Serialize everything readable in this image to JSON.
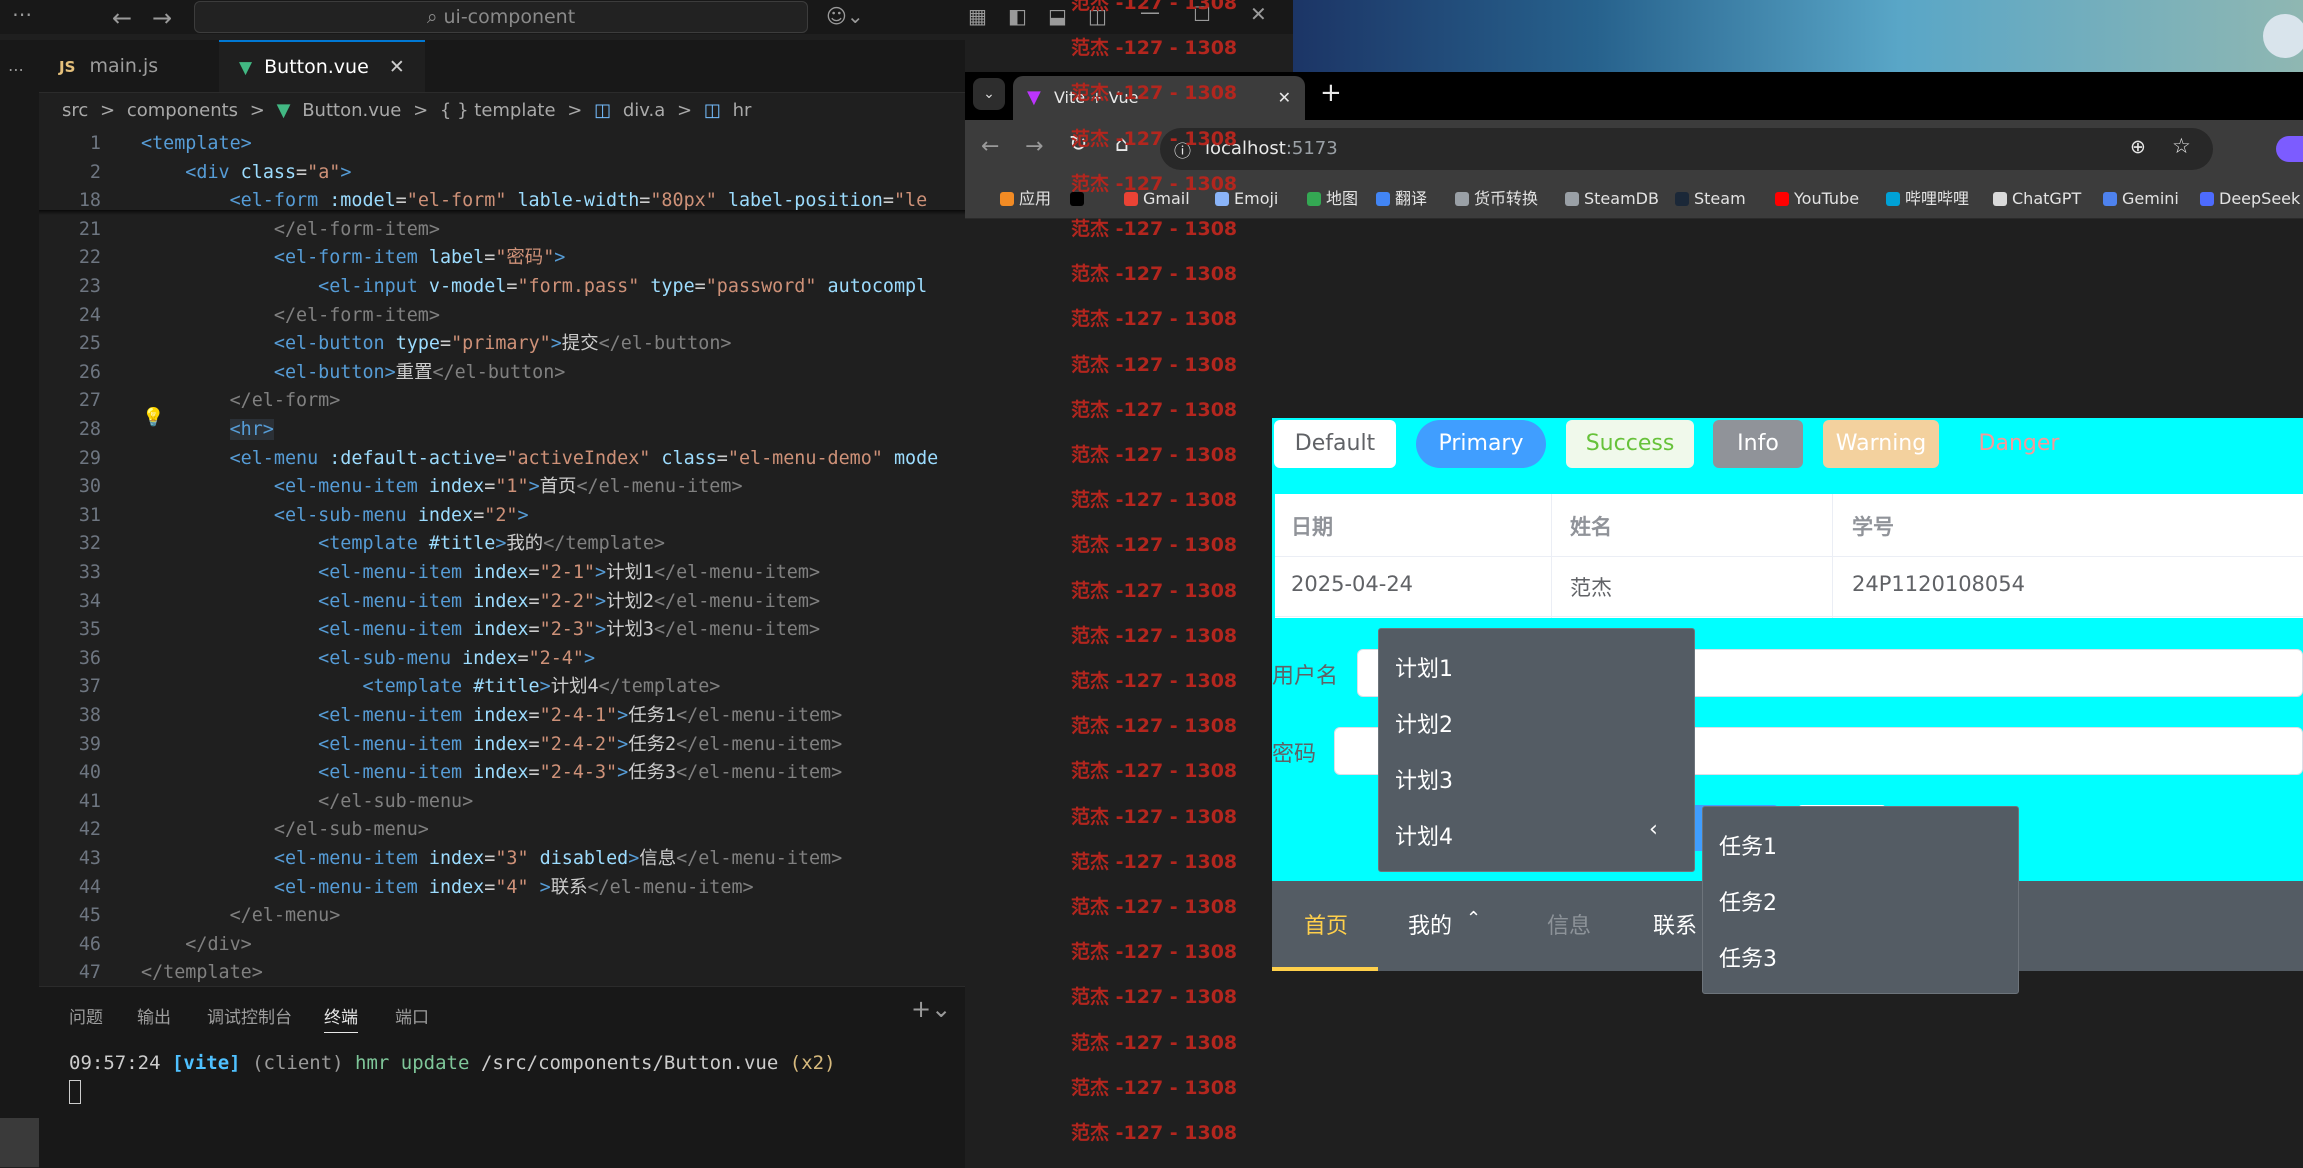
{
  "vscode": {
    "search": "ui-component",
    "tabs": [
      "main.js",
      "Button.vue"
    ],
    "tab_js_badge": "JS",
    "breadcrumb": [
      "src",
      ">",
      "components",
      ">",
      "Button.vue",
      ">",
      "{ } template",
      ">",
      "div.a",
      ">",
      "hr"
    ],
    "code_lines": [
      {
        "n": "1",
        "html": "<span class='tg'>&lt;template&gt;</span>"
      },
      {
        "n": "2",
        "html": "    <span class='tg'>&lt;div</span> <span class='at'>class</span>=<span class='st'>\"a\"</span><span class='tg'>&gt;</span>"
      },
      {
        "n": "18",
        "html": "        <span class='tg'>&lt;el-form</span> <span class='at'>:model</span>=<span class='st'>\"el-form\"</span> <span class='at'>lable-width</span>=<span class='st'>\"80px\"</span> <span class='at'>label-position</span>=<span class='st'>\"le</span>"
      },
      {
        "n": "21",
        "html": "            <span class='gy'>&lt;/el-form-item&gt;</span>"
      },
      {
        "n": "22",
        "html": "            <span class='tg'>&lt;el-form-item</span> <span class='at'>label</span>=<span class='st'>\"密码\"</span><span class='tg'>&gt;</span>"
      },
      {
        "n": "23",
        "html": "                <span class='tg'>&lt;el-input</span> <span class='at'>v-model</span>=<span class='st'>\"form.pass\"</span> <span class='at'>type</span>=<span class='st'>\"password\"</span> <span class='at'>autocompl</span>"
      },
      {
        "n": "24",
        "html": "            <span class='gy'>&lt;/el-form-item&gt;</span>"
      },
      {
        "n": "25",
        "html": "            <span class='tg'>&lt;el-button</span> <span class='at'>type</span>=<span class='st'>\"primary\"</span><span class='tg'>&gt;</span>提交<span class='gy'>&lt;/el-button&gt;</span>"
      },
      {
        "n": "26",
        "html": "            <span class='tg'>&lt;el-button&gt;</span>重置<span class='gy'>&lt;/el-button&gt;</span>"
      },
      {
        "n": "27",
        "html": "        <span class='gy'>&lt;/el-form&gt;</span>"
      },
      {
        "n": "28",
        "html": "        <span class='tg hl'>&lt;hr&gt;</span>"
      },
      {
        "n": "29",
        "html": "        <span class='tg'>&lt;el-menu</span> <span class='at'>:default-active</span>=<span class='st'>\"activeIndex\"</span> <span class='at'>class</span>=<span class='st'>\"el-menu-demo\"</span> <span class='at'>mode</span>"
      },
      {
        "n": "30",
        "html": "            <span class='tg'>&lt;el-menu-item</span> <span class='at'>index</span>=<span class='st'>\"1\"</span><span class='tg'>&gt;</span>首页<span class='gy'>&lt;/el-menu-item&gt;</span>"
      },
      {
        "n": "31",
        "html": "            <span class='tg'>&lt;el-sub-menu</span> <span class='at'>index</span>=<span class='st'>\"2\"</span><span class='tg'>&gt;</span>"
      },
      {
        "n": "32",
        "html": "                <span class='tg'>&lt;template</span> <span class='at'>#title</span><span class='tg'>&gt;</span>我的<span class='gy'>&lt;/template&gt;</span>"
      },
      {
        "n": "33",
        "html": "                <span class='tg'>&lt;el-menu-item</span> <span class='at'>index</span>=<span class='st'>\"2-1\"</span><span class='tg'>&gt;</span>计划1<span class='gy'>&lt;/el-menu-item&gt;</span>"
      },
      {
        "n": "34",
        "html": "                <span class='tg'>&lt;el-menu-item</span> <span class='at'>index</span>=<span class='st'>\"2-2\"</span><span class='tg'>&gt;</span>计划2<span class='gy'>&lt;/el-menu-item&gt;</span>"
      },
      {
        "n": "35",
        "html": "                <span class='tg'>&lt;el-menu-item</span> <span class='at'>index</span>=<span class='st'>\"2-3\"</span><span class='tg'>&gt;</span>计划3<span class='gy'>&lt;/el-menu-item&gt;</span>"
      },
      {
        "n": "36",
        "html": "                <span class='tg'>&lt;el-sub-menu</span> <span class='at'>index</span>=<span class='st'>\"2-4\"</span><span class='tg'>&gt;</span>"
      },
      {
        "n": "37",
        "html": "                    <span class='tg'>&lt;template</span> <span class='at'>#title</span><span class='tg'>&gt;</span>计划4<span class='gy'>&lt;/template&gt;</span>"
      },
      {
        "n": "38",
        "html": "                <span class='tg'>&lt;el-menu-item</span> <span class='at'>index</span>=<span class='st'>\"2-4-1\"</span><span class='tg'>&gt;</span>任务1<span class='gy'>&lt;/el-menu-item&gt;</span>"
      },
      {
        "n": "39",
        "html": "                <span class='tg'>&lt;el-menu-item</span> <span class='at'>index</span>=<span class='st'>\"2-4-2\"</span><span class='tg'>&gt;</span>任务2<span class='gy'>&lt;/el-menu-item&gt;</span>"
      },
      {
        "n": "40",
        "html": "                <span class='tg'>&lt;el-menu-item</span> <span class='at'>index</span>=<span class='st'>\"2-4-3\"</span><span class='tg'>&gt;</span>任务3<span class='gy'>&lt;/el-menu-item&gt;</span>"
      },
      {
        "n": "41",
        "html": "                <span class='gy'>&lt;/el-sub-menu&gt;</span>"
      },
      {
        "n": "42",
        "html": "            <span class='gy'>&lt;/el-sub-menu&gt;</span>"
      },
      {
        "n": "43",
        "html": "            <span class='tg'>&lt;el-menu-item</span> <span class='at'>index</span>=<span class='st'>\"3\"</span> <span class='at'>disabled</span><span class='tg'>&gt;</span>信息<span class='gy'>&lt;/el-menu-item&gt;</span>"
      },
      {
        "n": "44",
        "html": "            <span class='tg'>&lt;el-menu-item</span> <span class='at'>index</span>=<span class='st'>\"4\"</span> <span class='tg'>&gt;</span>联系<span class='gy'>&lt;/el-menu-item&gt;</span>"
      },
      {
        "n": "45",
        "html": "        <span class='gy'>&lt;/el-menu&gt;</span>"
      },
      {
        "n": "46",
        "html": "    <span class='gy'>&lt;/div&gt;</span>"
      },
      {
        "n": "47",
        "html": "<span class='gy'>&lt;/template&gt;</span>"
      }
    ],
    "panel_tabs": [
      "问题",
      "输出",
      "调试控制台",
      "终端",
      "端口"
    ],
    "terminal": {
      "time": "09:57:24",
      "tag": "[vite]",
      "client": "(client)",
      "msg": "hmr update",
      "path": "/src/components/Button.vue",
      "count": "(x2)"
    }
  },
  "chrome": {
    "tab_title": "Vite + Vue",
    "url_host": "localhost",
    "url_port": ":5173",
    "bookmarks": [
      {
        "label": "应用",
        "color": "#f28b24"
      },
      {
        "label": "",
        "color": "#000000"
      },
      {
        "label": "Gmail",
        "color": "#ea4335"
      },
      {
        "label": "Emoji",
        "color": "#8ab4f8"
      },
      {
        "label": "地图",
        "color": "#34a853"
      },
      {
        "label": "翻译",
        "color": "#4285f4"
      },
      {
        "label": "货币转换",
        "color": "#9aa0a6"
      },
      {
        "label": "SteamDB",
        "color": "#9aa0a6"
      },
      {
        "label": "Steam",
        "color": "#1b2838"
      },
      {
        "label": "YouTube",
        "color": "#ff0000"
      },
      {
        "label": "哔哩哔哩",
        "color": "#00a1d6"
      },
      {
        "label": "ChatGPT",
        "color": "#d9d9d9"
      },
      {
        "label": "Gemini",
        "color": "#4e82ee"
      },
      {
        "label": "DeepSeek",
        "color": "#4d6bfe"
      }
    ]
  },
  "app": {
    "watermark": "范杰 -127 - 1308",
    "buttons": [
      {
        "label": "Default",
        "bg": "#ffffff",
        "fg": "#606266",
        "round": false
      },
      {
        "label": "Primary",
        "bg": "#409eff",
        "fg": "#ffffff",
        "round": true
      },
      {
        "label": "Success",
        "bg": "#f0f9eb",
        "fg": "#67c23a",
        "round": false
      },
      {
        "label": "Info",
        "bg": "#909399",
        "fg": "#ffffff",
        "round": false
      },
      {
        "label": "Warning",
        "bg": "#f3d19e",
        "fg": "#ffffff",
        "round": false
      },
      {
        "label": "Danger",
        "bg": "transparent",
        "fg": "#f89898",
        "round": false
      }
    ],
    "table": {
      "headers": [
        "日期",
        "姓名",
        "学号"
      ],
      "row": [
        "2025-04-24",
        "范杰",
        "24P1120108054"
      ]
    },
    "form": {
      "username_label": "用户名",
      "password_label": "密码"
    },
    "menu": [
      {
        "label": "首页",
        "state": "active"
      },
      {
        "label": "我的",
        "state": "open"
      },
      {
        "label": "信息",
        "state": "disabled"
      },
      {
        "label": "联系",
        "state": "normal"
      }
    ],
    "popup_plans": [
      "计划1",
      "计划2",
      "计划3",
      "计划4"
    ],
    "popup_tasks": [
      "任务1",
      "任务2",
      "任务3"
    ],
    "colors": {
      "active": "#ffd04b",
      "menu_bg": "#545c64",
      "canvas": "#00ffff",
      "watermark": "#b3261e"
    }
  }
}
